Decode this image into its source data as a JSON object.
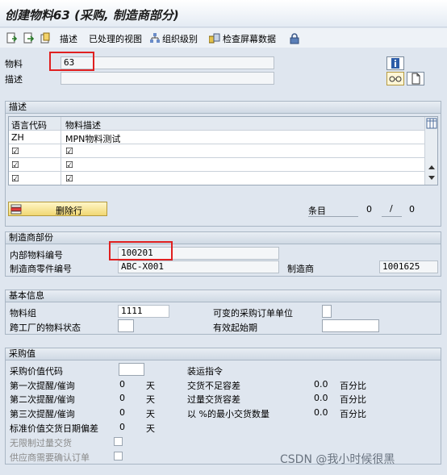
{
  "window": {
    "title": "创建物料63 (采购, 制造商部分)"
  },
  "toolbar": {
    "describe": "描述",
    "processed_views": "已处理的视图",
    "org_levels": "组织级别",
    "check_screen_data": "检查屏幕数据"
  },
  "header": {
    "material_label": "物料",
    "material_value": "63",
    "desc_label": "描述",
    "desc_value": ""
  },
  "desc_group": {
    "title": "描述",
    "col_lang": "语言代码",
    "col_desc": "物料描述",
    "rows": [
      {
        "lang": "ZH",
        "desc": "MPN物料测试"
      },
      {
        "lang": "☑",
        "desc": "☑"
      },
      {
        "lang": "☑",
        "desc": "☑"
      },
      {
        "lang": "☑",
        "desc": "☑"
      }
    ],
    "delete_row": "删除行",
    "entries_label": "条目",
    "entry_current": "0",
    "entry_total": "0"
  },
  "mfr_group": {
    "title": "制造商部份",
    "internal_no_label": "内部物料编号",
    "internal_no_value": "100201",
    "mfr_part_label": "制造商零件编号",
    "mfr_part_value": "ABC-X001",
    "mfr_label": "制造商",
    "mfr_value": "1001625"
  },
  "basic_group": {
    "title": "基本信息",
    "material_group_label": "物料组",
    "material_group_value": "1111",
    "variable_po_unit_label": "可变的采购订单单位",
    "cross_plant_status_label": "跨工厂的物料状态",
    "valid_from_label": "有效起始期"
  },
  "purch_group": {
    "title": "采购值",
    "purch_value_key_label": "采购价值代码",
    "shipping_instr_label": "装运指令",
    "reminder1_label": "第一次提醒/催询",
    "reminder1_value": "0",
    "reminder2_label": "第二次提醒/催询",
    "reminder2_value": "0",
    "reminder3_label": "第三次提醒/催询",
    "reminder3_value": "0",
    "std_dev_label": "标准价值交货日期偏差",
    "std_dev_value": "0",
    "days_unit": "天",
    "underdelivery_label": "交货不足容差",
    "underdelivery_value": "0.0",
    "overdelivery_label": "过量交货容差",
    "overdelivery_value": "0.0",
    "min_delivery_label": "以 %的最小交货数量",
    "min_delivery_value": "0.0",
    "percent_unit": "百分比",
    "unlimited_over_label": "无限制过量交货",
    "ack_required_label": "供应商需要确认订单"
  },
  "watermark": "CSDN @我小时候很黑"
}
